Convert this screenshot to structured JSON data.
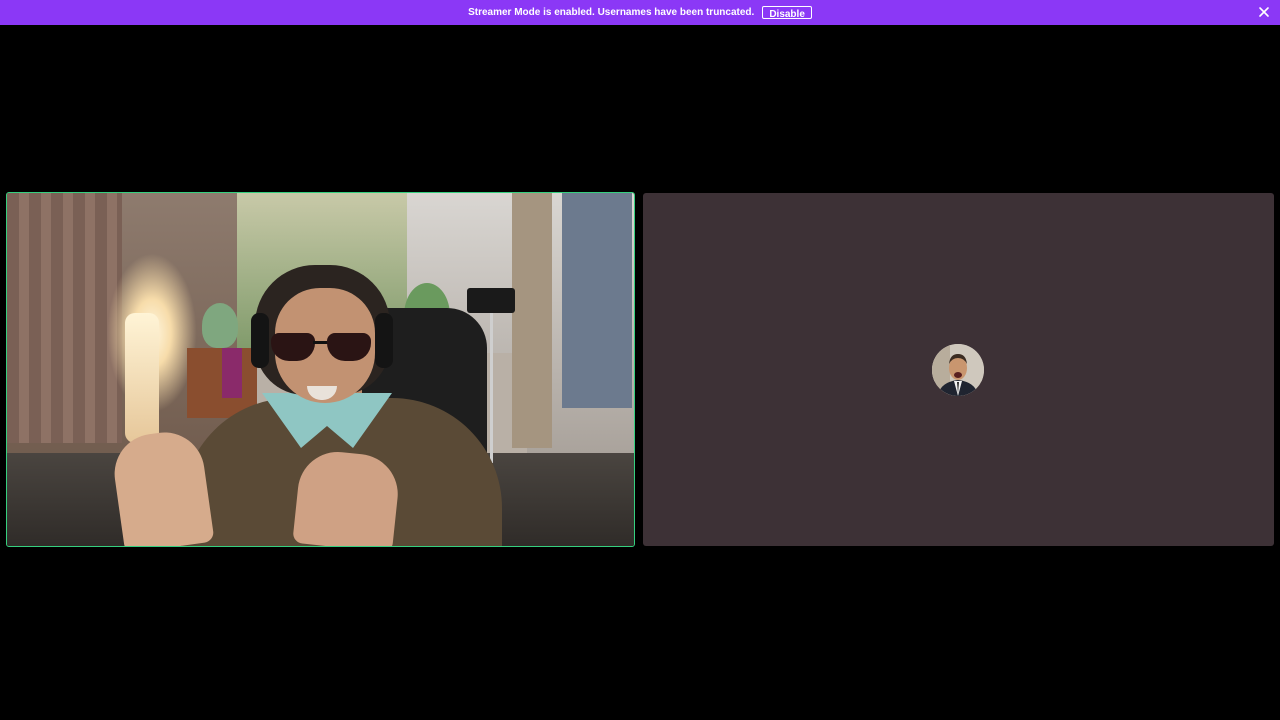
{
  "notice_bar": {
    "message": "Streamer Mode is enabled. Usernames have been truncated.",
    "disable_label": "Disable",
    "background_color": "#8b38f6"
  },
  "video_grid": {
    "participants": [
      {
        "type": "webcam-video",
        "speaking": true,
        "highlight_color": "#35d07f"
      },
      {
        "type": "avatar",
        "speaking": false,
        "tile_color": "#3d3136"
      }
    ]
  },
  "icons": {
    "close": "close-icon"
  }
}
